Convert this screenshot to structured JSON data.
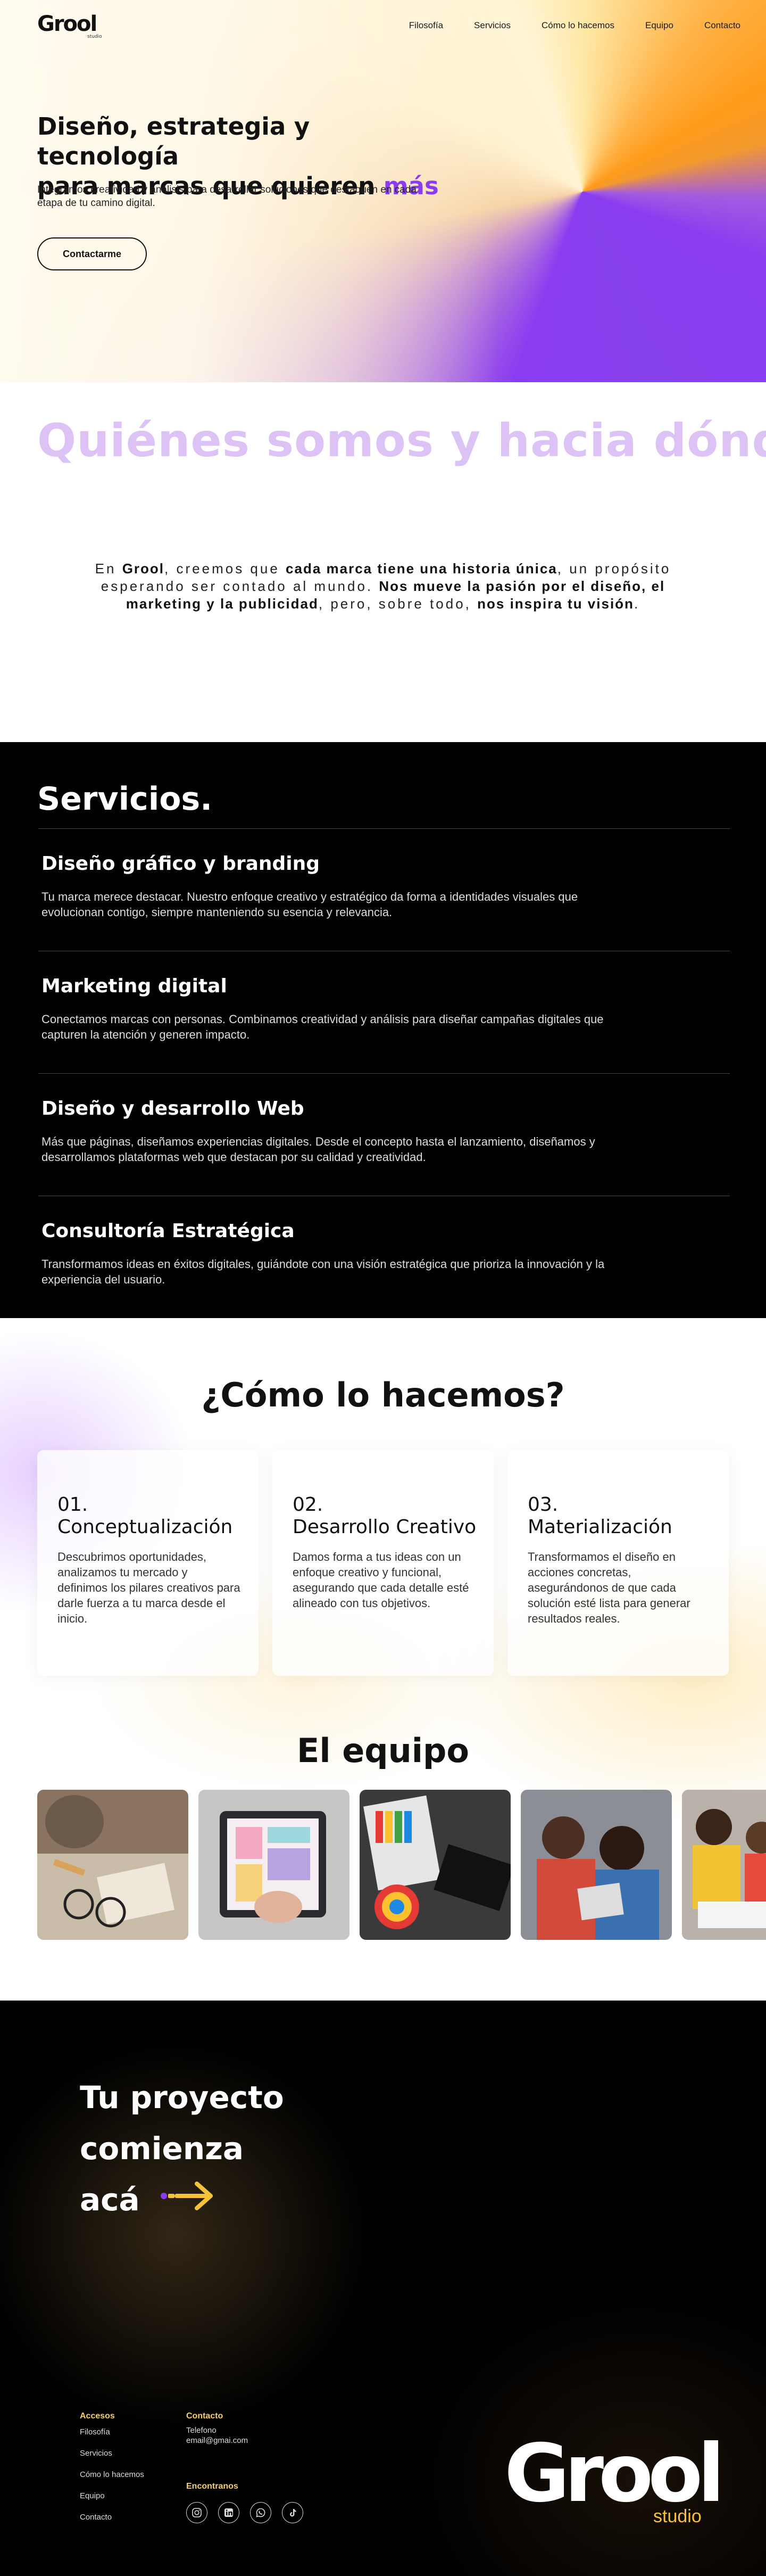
{
  "brand": {
    "logo_text": "Grool",
    "logo_sub": "studio",
    "accent": "#8a3df0",
    "gold": "#f5c23a"
  },
  "nav": {
    "items": [
      "Filosofía",
      "Servicios",
      "Cómo lo hacemos",
      "Equipo",
      "Contacto"
    ]
  },
  "hero": {
    "title_line1": "Diseño, estrategia y tecnología",
    "title_line2_prefix": "para marcas que quieren ",
    "title_accent": "más",
    "subtitle": "Integramos creatividad y análisis para desarrollar soluciones que destaquen en cada etapa de tu camino digital.",
    "cta_label": "Contactarme"
  },
  "about": {
    "marquee": "Quiénes somos y hacia dónde vamos",
    "t1": "En ",
    "b1": "Grool",
    "t2": ", creemos que ",
    "b2": "cada marca tiene una historia única",
    "t3": ", un propósito esperando ser contado al mundo. ",
    "b3": "Nos mueve la pasión por el diseño, el marketing y la publicidad",
    "t4": ", pero, sobre todo, ",
    "b4": "nos inspira tu visión",
    "t5": "."
  },
  "services": {
    "heading": "Servicios.",
    "items": [
      {
        "title": "Diseño gráfico y branding",
        "desc": "Tu marca merece destacar. Nuestro enfoque creativo y estratégico da forma a identidades visuales que evolucionan contigo, siempre manteniendo su esencia y relevancia."
      },
      {
        "title": "Marketing digital",
        "desc": "Conectamos marcas con personas. Combinamos creatividad y análisis para diseñar campañas digitales que capturen la atención y generen impacto."
      },
      {
        "title": "Diseño y desarrollo Web",
        "desc": "Más que páginas, diseñamos experiencias digitales. Desde el concepto hasta el lanzamiento, diseñamos y desarrollamos plataformas web que destacan por su calidad y creatividad."
      },
      {
        "title": "Consultoría Estratégica",
        "desc": "Transformamos ideas en éxitos digitales, guiándote con una visión estratégica que prioriza la innovación y la experiencia del usuario."
      }
    ]
  },
  "how": {
    "heading": "¿Cómo lo hacemos?",
    "cards": [
      {
        "num": "01.",
        "title": "Conceptualización",
        "desc": "Descubrimos oportunidades, analizamos tu mercado y definimos los pilares creativos para darle fuerza a tu marca desde el inicio."
      },
      {
        "num": "02.",
        "title": "Desarrollo Creativo",
        "desc": "Damos forma a tus ideas con un enfoque creativo y funcional, asegurando que cada detalle esté alineado con tus objetivos."
      },
      {
        "num": "03.",
        "title": "Materialización",
        "desc": "Transformamos el diseño en acciones concretas, asegurándonos de que cada solución esté lista para generar resultados reales."
      }
    ]
  },
  "team": {
    "heading": "El equipo"
  },
  "cta": {
    "line1": "Tu proyecto",
    "line2": "comienza",
    "line3": "acá"
  },
  "footer": {
    "accesos_heading": "Accesos",
    "links": [
      "Filosofía",
      "Servicios",
      "Cómo lo hacemos",
      "Equipo",
      "Contacto"
    ],
    "contacto_heading": "Contacto",
    "phone_label": "Telefono",
    "email": "email@gmai.com",
    "encontranos_heading": "Encontranos",
    "socials": [
      "instagram-icon",
      "linkedin-icon",
      "whatsapp-icon",
      "tiktok-icon"
    ],
    "logo_text": "Grool",
    "logo_sub": "studio"
  }
}
